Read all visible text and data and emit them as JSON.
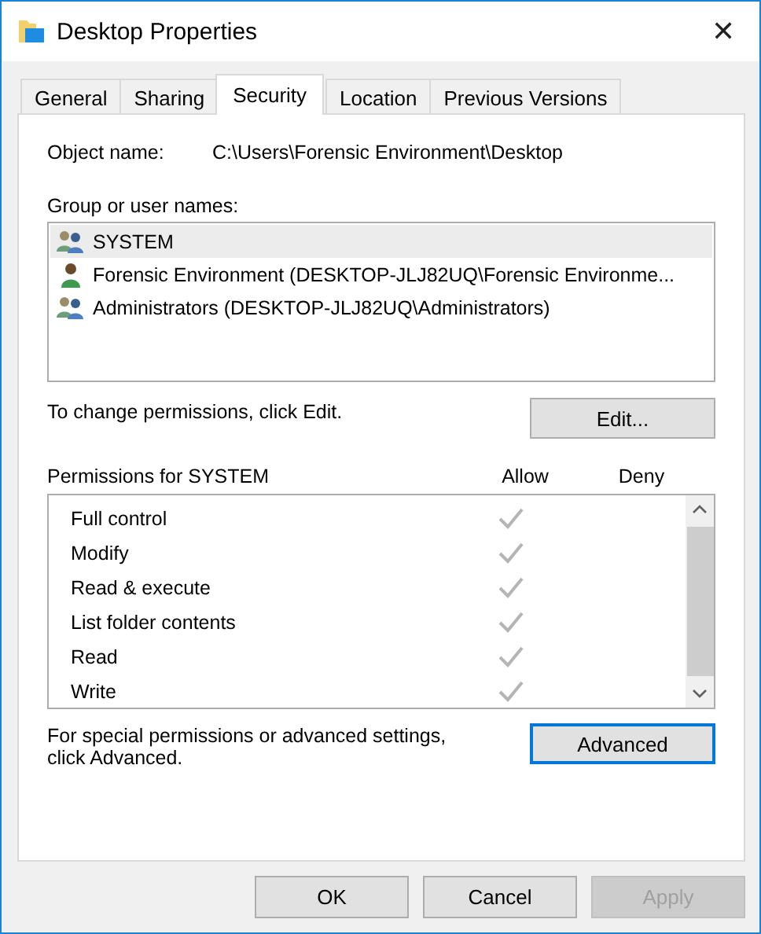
{
  "window": {
    "title": "Desktop Properties",
    "close": "✕"
  },
  "tabs": [
    {
      "label": "General",
      "selected": false
    },
    {
      "label": "Sharing",
      "selected": false
    },
    {
      "label": "Security",
      "selected": true
    },
    {
      "label": "Location",
      "selected": false
    },
    {
      "label": "Previous Versions",
      "selected": false
    }
  ],
  "object_name": {
    "label": "Object name:",
    "value": "C:\\Users\\Forensic Environment\\Desktop"
  },
  "groups": {
    "label": "Group or user names:",
    "items": [
      {
        "kind": "group",
        "name": "SYSTEM",
        "selected": true
      },
      {
        "kind": "user",
        "name": "Forensic Environment (DESKTOP-JLJ82UQ\\Forensic Environme...",
        "selected": false
      },
      {
        "kind": "group",
        "name": "Administrators (DESKTOP-JLJ82UQ\\Administrators)",
        "selected": false
      }
    ]
  },
  "edit_hint": "To change permissions, click Edit.",
  "edit_button": "Edit...",
  "permissions": {
    "label": "Permissions for SYSTEM",
    "allow_header": "Allow",
    "deny_header": "Deny",
    "rows": [
      {
        "name": "Full control",
        "allow": true,
        "deny": false
      },
      {
        "name": "Modify",
        "allow": true,
        "deny": false
      },
      {
        "name": "Read & execute",
        "allow": true,
        "deny": false
      },
      {
        "name": "List folder contents",
        "allow": true,
        "deny": false
      },
      {
        "name": "Read",
        "allow": true,
        "deny": false
      },
      {
        "name": "Write",
        "allow": true,
        "deny": false
      }
    ]
  },
  "advanced_hint": "For special permissions or advanced settings, click Advanced.",
  "advanced_button": "Advanced",
  "buttons": [
    {
      "label": "OK",
      "disabled": false
    },
    {
      "label": "Cancel",
      "disabled": false
    },
    {
      "label": "Apply",
      "disabled": true
    }
  ]
}
